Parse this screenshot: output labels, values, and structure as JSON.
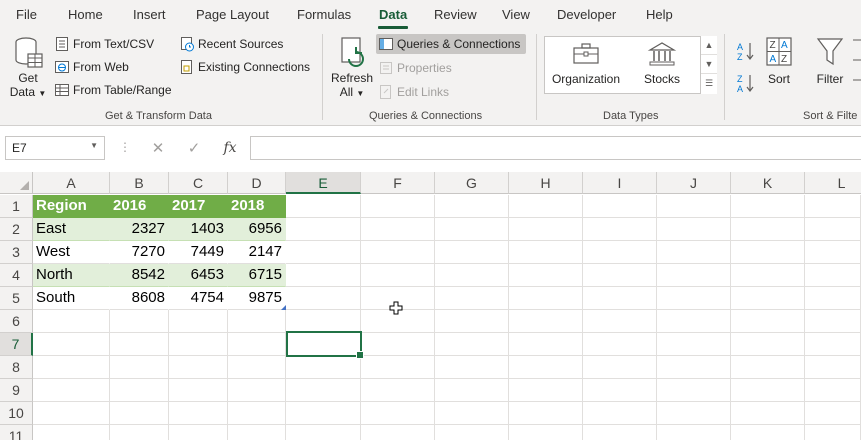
{
  "menu": {
    "tabs": [
      "File",
      "Home",
      "Insert",
      "Page Layout",
      "Formulas",
      "Data",
      "Review",
      "View",
      "Developer",
      "Help"
    ],
    "active": "Data"
  },
  "ribbon": {
    "get_transform": {
      "get_data": [
        "Get",
        "Data"
      ],
      "from_text_csv": "From Text/CSV",
      "from_web": "From Web",
      "from_table_range": "From Table/Range",
      "recent_sources": "Recent Sources",
      "existing_connections": "Existing Connections",
      "group_label": "Get & Transform Data"
    },
    "queries": {
      "refresh_all": [
        "Refresh",
        "All"
      ],
      "queries_connections": "Queries & Connections",
      "properties": "Properties",
      "edit_links": "Edit Links",
      "group_label": "Queries & Connections"
    },
    "data_types": {
      "organization": "Organization",
      "stocks": "Stocks",
      "group_label": "Data Types"
    },
    "sort_filter": {
      "sort": "Sort",
      "filter": "Filter",
      "group_label": "Sort & Filte"
    }
  },
  "formula_bar": {
    "name_box": "E7",
    "fx": "fx",
    "value": ""
  },
  "grid": {
    "columns": [
      "A",
      "B",
      "C",
      "D",
      "E",
      "F",
      "G",
      "H",
      "I",
      "J",
      "K",
      "L"
    ],
    "rows": [
      "1",
      "2",
      "3",
      "4",
      "5",
      "6",
      "7",
      "8",
      "9",
      "10",
      "11"
    ],
    "selected_column": "E",
    "selected_row": "7",
    "table": {
      "header": [
        "Region",
        "2016",
        "2017",
        "2018"
      ],
      "rows": [
        [
          "East",
          "2327",
          "1403",
          "6956"
        ],
        [
          "West",
          "7270",
          "7449",
          "2147"
        ],
        [
          "North",
          "8542",
          "6453",
          "6715"
        ],
        [
          "South",
          "8608",
          "4754",
          "9875"
        ]
      ]
    }
  },
  "colors": {
    "accent": "#217346",
    "table_header": "#70ad47",
    "table_band": "#e2efda"
  }
}
